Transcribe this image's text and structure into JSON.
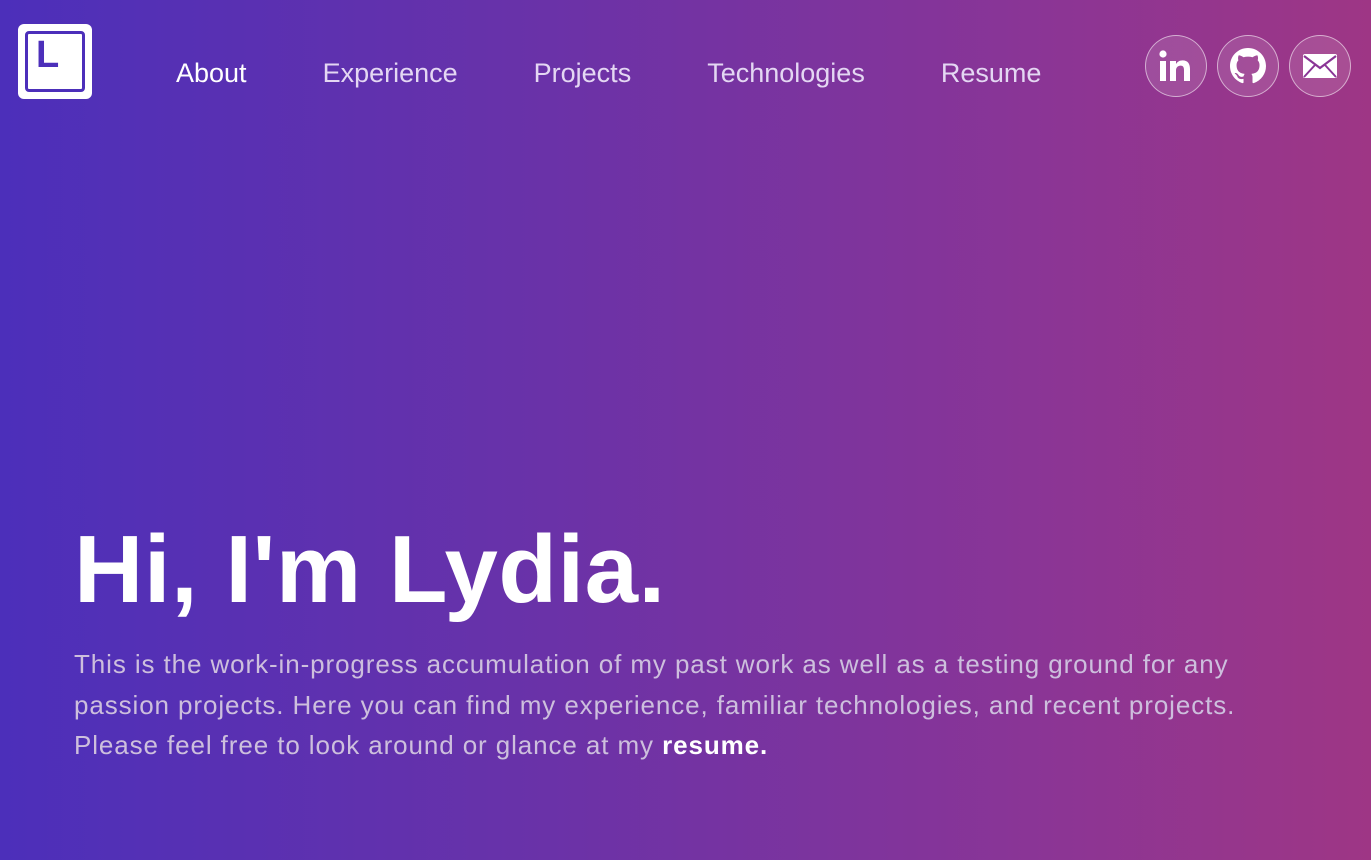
{
  "logo": {
    "letter": "L"
  },
  "nav": {
    "items": [
      {
        "label": "About",
        "active": true
      },
      {
        "label": "Experience",
        "active": false
      },
      {
        "label": "Projects",
        "active": false
      },
      {
        "label": "Technologies",
        "active": false
      },
      {
        "label": "Resume",
        "active": false
      }
    ]
  },
  "socials": [
    {
      "icon": "linkedin-icon"
    },
    {
      "icon": "github-icon"
    },
    {
      "icon": "mail-icon"
    }
  ],
  "hero": {
    "title": "Hi, I'm Lydia.",
    "description": "This is the work-in-progress accumulation of my past work as well as a testing ground for any passion projects. Here you can find my experience, familiar technologies, and recent projects. Please feel free to look around or glance at my",
    "resume_link": "resume."
  },
  "colors": {
    "gradient_start": "#4c2fba",
    "gradient_end": "#9e3685",
    "nav_text": "#e4d7f3",
    "nav_active": "#ffffff",
    "body_text": "#cdbfdd"
  }
}
